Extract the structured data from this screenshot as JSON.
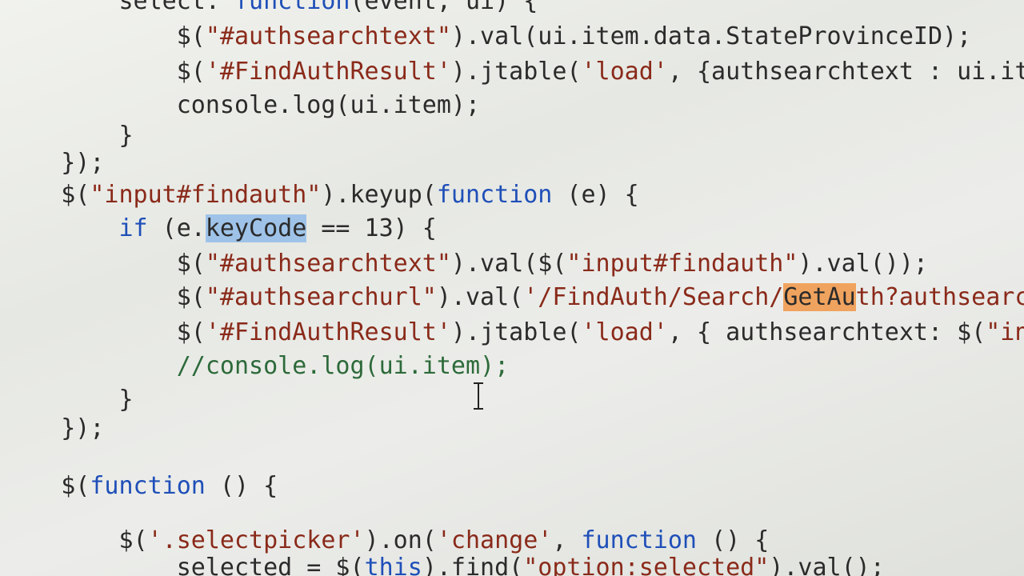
{
  "editor": {
    "lines": [
      {
        "indent": "        ",
        "parts": [
          {
            "t": "select: ",
            "c": ""
          },
          {
            "t": "function",
            "c": "kw"
          },
          {
            "t": "(event, ui) {",
            "c": ""
          }
        ]
      },
      {
        "indent": "            ",
        "parts": [
          {
            "t": "$(",
            "c": ""
          },
          {
            "t": "\"#authsearchtext\"",
            "c": "str"
          },
          {
            "t": ").val(ui.item.data.StateProvinceID);",
            "c": ""
          }
        ]
      },
      {
        "indent": "            ",
        "parts": [
          {
            "t": "$(",
            "c": ""
          },
          {
            "t": "'#FindAuthResult'",
            "c": "str"
          },
          {
            "t": ").jtable(",
            "c": ""
          },
          {
            "t": "'load'",
            "c": "str"
          },
          {
            "t": ", {authsearchtext : ui.ite",
            "c": ""
          }
        ]
      },
      {
        "indent": "            ",
        "parts": [
          {
            "t": "console.log(ui.item);",
            "c": ""
          }
        ]
      },
      {
        "indent": "        ",
        "parts": [
          {
            "t": "}",
            "c": ""
          }
        ]
      },
      {
        "indent": "    ",
        "parts": [
          {
            "t": "});",
            "c": ""
          }
        ]
      },
      {
        "indent": "    ",
        "parts": [
          {
            "t": "$(",
            "c": ""
          },
          {
            "t": "\"input#findauth\"",
            "c": "str"
          },
          {
            "t": ").keyup(",
            "c": ""
          },
          {
            "t": "function",
            "c": "kw"
          },
          {
            "t": " (e) {",
            "c": ""
          }
        ]
      },
      {
        "indent": "        ",
        "parts": [
          {
            "t": "if",
            "c": "kw"
          },
          {
            "t": " (e.",
            "c": ""
          },
          {
            "t": "keyCode",
            "c": "sel"
          },
          {
            "t": " == 13) {",
            "c": ""
          }
        ]
      },
      {
        "indent": "            ",
        "parts": [
          {
            "t": "$(",
            "c": ""
          },
          {
            "t": "\"#authsearchtext\"",
            "c": "str"
          },
          {
            "t": ").val($(",
            "c": ""
          },
          {
            "t": "\"input#findauth\"",
            "c": "str"
          },
          {
            "t": ").val());",
            "c": ""
          }
        ]
      },
      {
        "indent": "            ",
        "parts": [
          {
            "t": "$(",
            "c": ""
          },
          {
            "t": "\"#authsearchurl\"",
            "c": "str"
          },
          {
            "t": ").val(",
            "c": ""
          },
          {
            "t": "'/FindAuth/Search/",
            "c": "str"
          },
          {
            "t": "GetAu",
            "c": "find"
          },
          {
            "t": "th?authsearch",
            "c": "str"
          }
        ]
      },
      {
        "indent": "            ",
        "parts": [
          {
            "t": "$(",
            "c": ""
          },
          {
            "t": "'#FindAuthResult'",
            "c": "str"
          },
          {
            "t": ").jtable(",
            "c": ""
          },
          {
            "t": "'load'",
            "c": "str"
          },
          {
            "t": ", { authsearchtext: $(",
            "c": ""
          },
          {
            "t": "\"inp",
            "c": "str"
          }
        ]
      },
      {
        "indent": "            ",
        "parts": [
          {
            "t": "//console.log(ui.item);",
            "c": "cmt"
          }
        ]
      },
      {
        "indent": "        ",
        "parts": [
          {
            "t": "}",
            "c": ""
          }
        ]
      },
      {
        "indent": "    ",
        "parts": [
          {
            "t": "});",
            "c": ""
          }
        ]
      },
      {
        "indent": "",
        "parts": []
      },
      {
        "indent": "    ",
        "parts": [
          {
            "t": "$(",
            "c": ""
          },
          {
            "t": "function",
            "c": "kw"
          },
          {
            "t": " () {",
            "c": ""
          }
        ]
      },
      {
        "indent": "",
        "parts": []
      },
      {
        "indent": "        ",
        "parts": [
          {
            "t": "$(",
            "c": ""
          },
          {
            "t": "'.selectpicker'",
            "c": "str"
          },
          {
            "t": ").on(",
            "c": ""
          },
          {
            "t": "'change'",
            "c": "str"
          },
          {
            "t": ", ",
            "c": ""
          },
          {
            "t": "function",
            "c": "kw"
          },
          {
            "t": " () {",
            "c": ""
          }
        ]
      },
      {
        "indent": "            ",
        "parts": [
          {
            "t": "selected = $(",
            "c": ""
          },
          {
            "t": "this",
            "c": "kw"
          },
          {
            "t": ").find(",
            "c": ""
          },
          {
            "t": "\"option:selected\"",
            "c": "str"
          },
          {
            "t": ").val();",
            "c": ""
          }
        ]
      }
    ],
    "selection_text": "keyCode",
    "find_match_text": "GetAu"
  }
}
